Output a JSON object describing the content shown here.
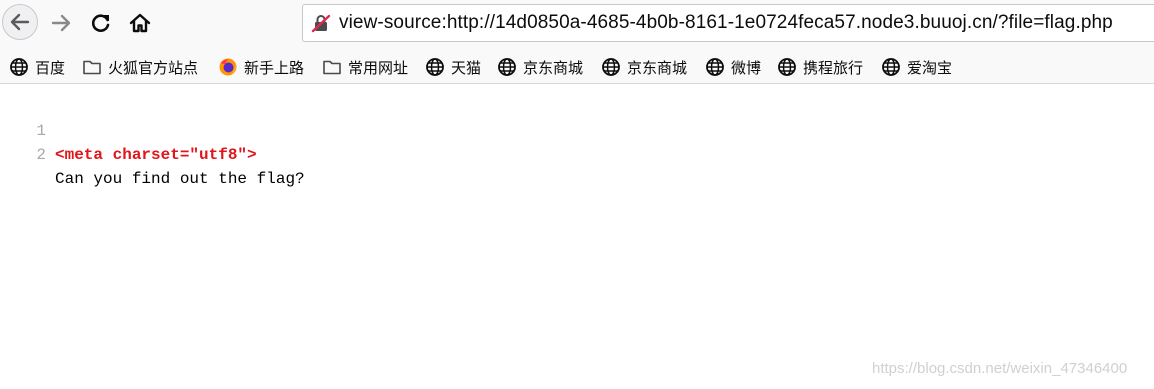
{
  "toolbar": {
    "back_icon": "arrow-left-icon",
    "forward_icon": "arrow-right-icon",
    "reload_icon": "reload-icon",
    "home_icon": "home-icon",
    "url": "view-source:http://14d0850a-4685-4b0b-8161-1e0724feca57.node3.buuoj.cn/?file=flag.php",
    "security_icon": "insecure-lock-icon"
  },
  "bookmarks": [
    {
      "label": "百度",
      "icon": "globe-icon"
    },
    {
      "label": "火狐官方站点",
      "icon": "folder-icon"
    },
    {
      "label": "新手上路",
      "icon": "firefox-icon"
    },
    {
      "label": "常用网址",
      "icon": "folder-icon"
    },
    {
      "label": "天猫",
      "icon": "globe-icon"
    },
    {
      "label": "京东商城",
      "icon": "globe-icon"
    },
    {
      "label": "京东商城",
      "icon": "globe-icon"
    },
    {
      "label": "微博",
      "icon": "globe-icon"
    },
    {
      "label": "携程旅行",
      "icon": "globe-icon"
    },
    {
      "label": "爱淘宝",
      "icon": "globe-icon"
    }
  ],
  "source": {
    "lines": [
      {
        "number": "1",
        "text": "<meta charset=\"utf8\">"
      },
      {
        "number": "2",
        "text": "Can you find out the flag?"
      }
    ]
  },
  "watermark": "https://blog.csdn.net/weixin_47346400",
  "colors": {
    "tag": "#e0161b",
    "line_number": "#a9a9a9",
    "toolbar_bg": "#f9f9fa"
  }
}
